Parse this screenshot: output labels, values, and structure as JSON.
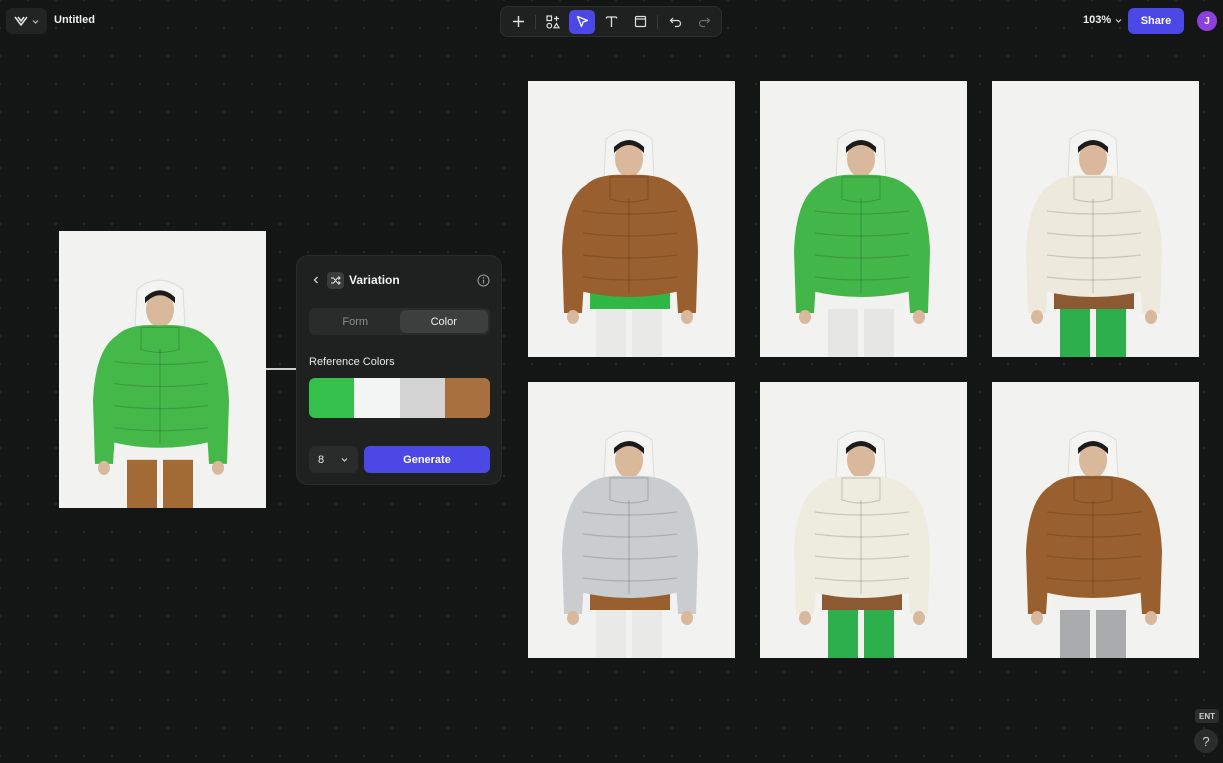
{
  "header": {
    "doc_title": "Untitled",
    "zoom": "103%",
    "share_label": "Share",
    "avatar_initial": "J"
  },
  "toolbar": {
    "tools": [
      "plus-icon",
      "components-icon",
      "pointer-icon",
      "text-icon",
      "frame-icon",
      "undo-icon",
      "redo-icon"
    ],
    "active_tool": "pointer-icon"
  },
  "panel": {
    "title": "Variation",
    "tabs": [
      {
        "label": "Form",
        "active": false
      },
      {
        "label": "Color",
        "active": true
      }
    ],
    "reference_label": "Reference Colors",
    "swatches": [
      "#34c04b",
      "#f3f4f4",
      "#d4d4d4",
      "#a9703f"
    ],
    "count_value": "8",
    "generate_label": "Generate"
  },
  "source_image": {
    "jacket": "#45b84a",
    "pants": "#a26a35"
  },
  "variations": [
    {
      "jacket": "#9a5f2e",
      "hem": "#2fb845",
      "pants": "#e9e9e7"
    },
    {
      "jacket": "#43b649",
      "hem": "#f1f1ef",
      "pants": "#e6e6e4"
    },
    {
      "jacket": "#ede9dc",
      "hem": "#8b5a33",
      "pants": "#2caf4c"
    },
    {
      "jacket": "#c9cdd0",
      "hem": "#9a5f2e",
      "pants": "#e9e9e7"
    },
    {
      "jacket": "#eeebdf",
      "hem": "#8b5a33",
      "pants": "#2caf4c"
    },
    {
      "jacket": "#9a5f2e",
      "hem": "#f1f1ef",
      "pants": "#a9abac"
    }
  ],
  "footer": {
    "ent_label": "ENT",
    "help_label": "?"
  }
}
